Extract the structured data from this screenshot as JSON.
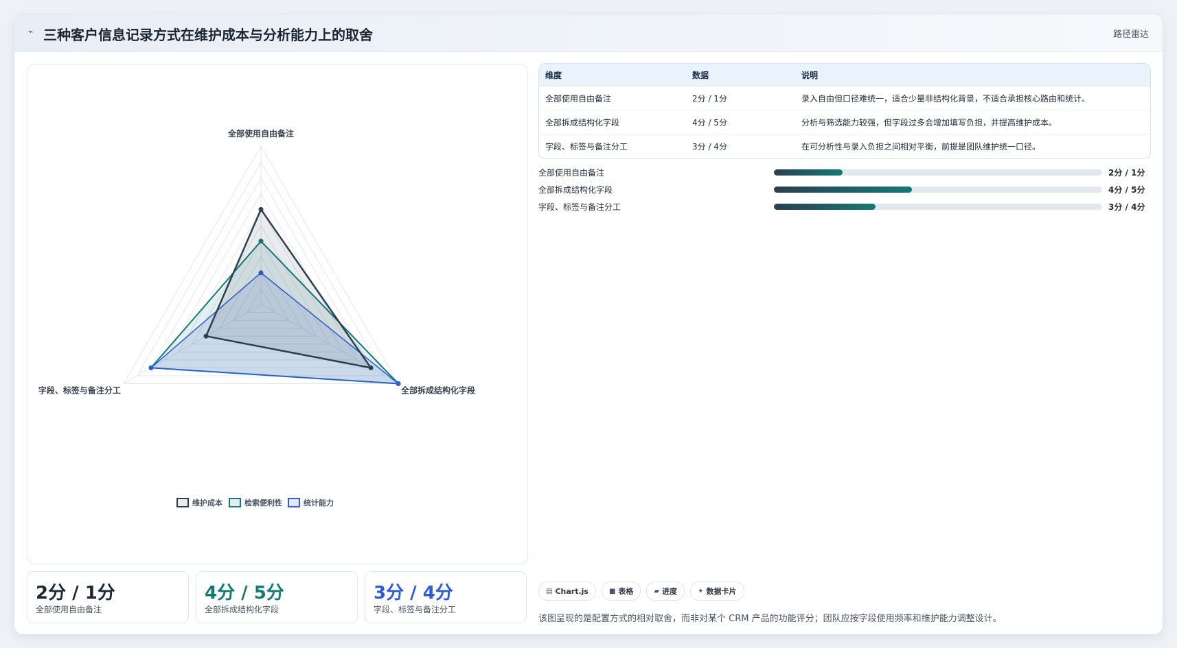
{
  "header": {
    "icon": "trend-icon",
    "title": "三种客户信息记录方式在维护成本与分析能力上的取舍",
    "tag": "路径雷达"
  },
  "colors": {
    "maintenance": "#2c3e50",
    "retrieval": "#157a74",
    "statistics": "#2f5bd3"
  },
  "chart_data": {
    "type": "radar",
    "axes": [
      "全部使用自由备注",
      "全部拆成结构化字段",
      "字段、标签与备注分工"
    ],
    "range": [
      0,
      5
    ],
    "grid": true,
    "legend_position": "bottom",
    "series": [
      {
        "name": "维护成本",
        "values": [
          3,
          4,
          2
        ]
      },
      {
        "name": "检索便利性",
        "values": [
          2,
          5,
          4
        ]
      },
      {
        "name": "统计能力",
        "values": [
          1,
          5,
          4
        ]
      }
    ]
  },
  "table": {
    "headers": [
      "维度",
      "数据",
      "说明"
    ],
    "rows": [
      [
        "全部使用自由备注",
        "2分 / 1分",
        "录入自由但口径难统一，适合少量非结构化背景，不适合承担核心路由和统计。"
      ],
      [
        "全部拆成结构化字段",
        "4分 / 5分",
        "分析与筛选能力较强，但字段过多会增加填写负担，并提高维护成本。"
      ],
      [
        "字段、标签与备注分工",
        "3分 / 4分",
        "在可分析性与录入负担之间相对平衡，前提是团队维护统一口径。"
      ]
    ]
  },
  "bars": [
    {
      "label": "全部使用自由备注",
      "value": "2分 / 1分",
      "fraction": 0.21
    },
    {
      "label": "全部拆成结构化字段",
      "value": "4分 / 5分",
      "fraction": 0.42
    },
    {
      "label": "字段、标签与备注分工",
      "value": "3分 / 4分",
      "fraction": 0.31
    }
  ],
  "kpis": [
    {
      "value": "2分 / 1分",
      "label": "全部使用自由备注",
      "color": "#1f2937"
    },
    {
      "value": "4分 / 5分",
      "label": "全部拆成结构化字段",
      "color": "#157a74"
    },
    {
      "value": "3分 / 4分",
      "label": "字段、标签与备注分工",
      "color": "#2f5bd3"
    }
  ],
  "tabs": [
    {
      "icon": "chart-icon",
      "glyph": "▤",
      "label": "Chart.js"
    },
    {
      "icon": "table-icon",
      "glyph": "■",
      "label": "表格"
    },
    {
      "icon": "progress-icon",
      "glyph": "▰",
      "label": "进度"
    },
    {
      "icon": "card-icon",
      "glyph": "✦",
      "label": "数据卡片"
    }
  ],
  "note": "该图呈现的是配置方式的相对取舍，而非对某个 CRM 产品的功能评分；团队应按字段使用频率和维护能力调整设计。"
}
